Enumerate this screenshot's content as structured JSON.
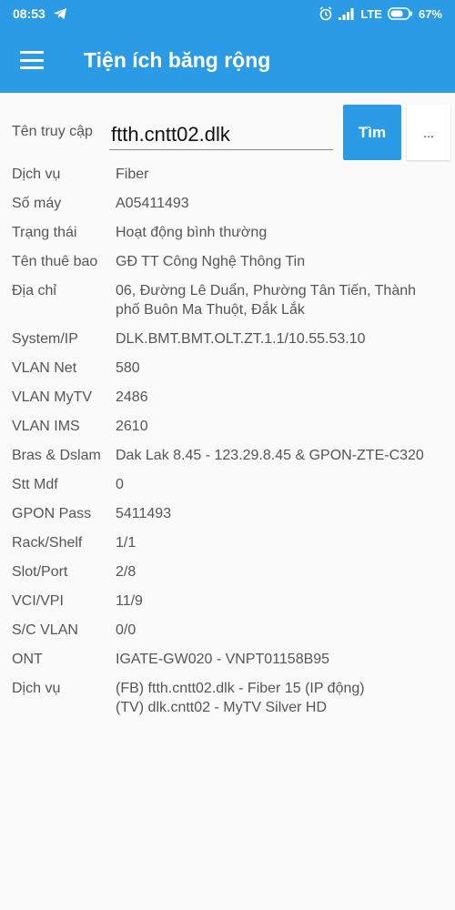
{
  "status_bar": {
    "time": "08:53",
    "network": "LTE",
    "battery": "67%"
  },
  "app_bar": {
    "title": "Tiện ích băng rộng"
  },
  "search": {
    "label": "Tên truy cập",
    "value": "ftth.cntt02.dlk",
    "button_label": "Tìm",
    "more_label": "..."
  },
  "info": [
    {
      "key": "Dịch vụ",
      "value": "Fiber"
    },
    {
      "key": "Số máy",
      "value": "A05411493"
    },
    {
      "key": "Trạng thái",
      "value": "Hoạt động bình thường"
    },
    {
      "key": "Tên thuê bao",
      "value": "GĐ TT Công Nghệ Thông Tin"
    },
    {
      "key": "Địa chỉ",
      "value": "06, Đường Lê Duẩn, Phường Tân Tiến, Thành phố Buôn Ma Thuột, Đắk Lắk"
    },
    {
      "key": "System/IP",
      "value": "DLK.BMT.BMT.OLT.ZT.1.1/10.55.53.10"
    },
    {
      "key": "VLAN Net",
      "value": "580"
    },
    {
      "key": "VLAN MyTV",
      "value": "2486"
    },
    {
      "key": "VLAN IMS",
      "value": "2610"
    },
    {
      "key": "Bras & Dslam",
      "value": "Dak Lak 8.45 - 123.29.8.45 & GPON-ZTE-C320"
    },
    {
      "key": "Stt Mdf",
      "value": "0"
    },
    {
      "key": "GPON Pass",
      "value": "5411493"
    },
    {
      "key": "Rack/Shelf",
      "value": "1/1"
    },
    {
      "key": "Slot/Port",
      "value": "2/8"
    },
    {
      "key": "VCI/VPI",
      "value": "11/9"
    },
    {
      "key": "S/C VLAN",
      "value": "0/0"
    },
    {
      "key": "ONT",
      "value": "IGATE-GW020 - VNPT01158B95"
    },
    {
      "key": "Dịch vụ",
      "value_lines": [
        "(FB) ftth.cntt02.dlk - Fiber 15 (IP động)",
        "(TV) dlk.cntt02 - MyTV Silver HD"
      ]
    }
  ]
}
